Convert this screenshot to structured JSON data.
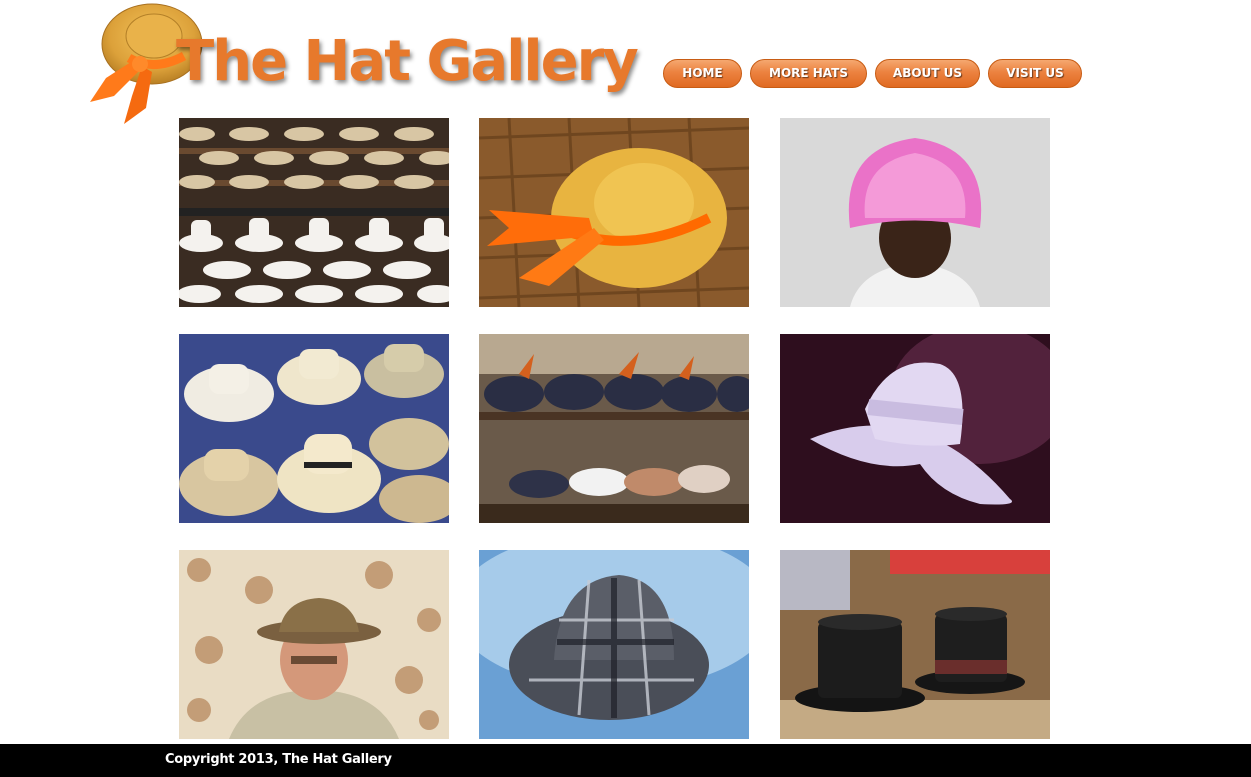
{
  "site": {
    "title": "The Hat Gallery",
    "brand_color": "#e7792c"
  },
  "nav": {
    "items": [
      {
        "label": "HOME"
      },
      {
        "label": "MORE HATS"
      },
      {
        "label": "ABOUT US"
      },
      {
        "label": "VISIT US"
      }
    ]
  },
  "gallery": {
    "photos": [
      {
        "subject": "shelves of straw and white hats"
      },
      {
        "subject": "straw hat with orange ribbon on wicker"
      },
      {
        "subject": "man in pink fuzzy bucket hat"
      },
      {
        "subject": "table of straw fedoras"
      },
      {
        "subject": "hat stall with feathered hats"
      },
      {
        "subject": "lavender wide brim hat"
      },
      {
        "subject": "man in tweed hat against floral wallpaper"
      },
      {
        "subject": "plaid fedora on blue background"
      },
      {
        "subject": "two black top hats on a bench"
      }
    ]
  },
  "footer": {
    "copyright": "Copyright 2013, The Hat Gallery"
  }
}
